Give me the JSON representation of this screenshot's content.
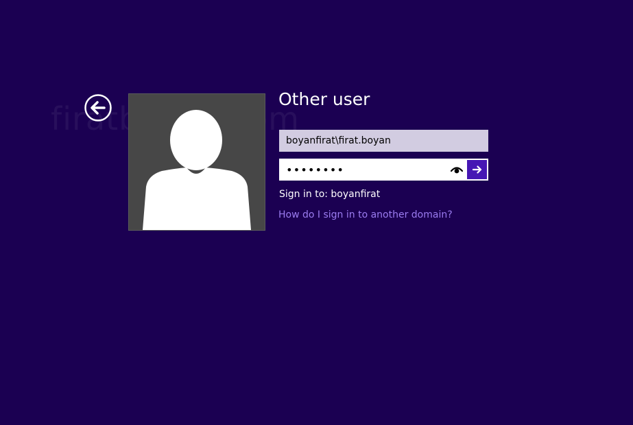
{
  "watermark": "firatboyan.com",
  "back": {
    "icon": "arrow-left-circle-icon"
  },
  "avatar": {
    "icon": "user-silhouette-icon"
  },
  "title": "Other user",
  "username": {
    "value": "boyanfirat\\firat.boyan"
  },
  "password": {
    "value": "••••••••",
    "reveal_icon": "eye-icon",
    "submit_icon": "arrow-right-icon"
  },
  "sign_in_to": "Sign in to: boyanfirat",
  "domain_link": "How do I sign in to another domain?",
  "colors": {
    "background": "#1b0052",
    "accent": "#4617b4",
    "link": "#9b7cf0",
    "username_field": "#d2cce1",
    "avatar_tile": "#474747"
  }
}
